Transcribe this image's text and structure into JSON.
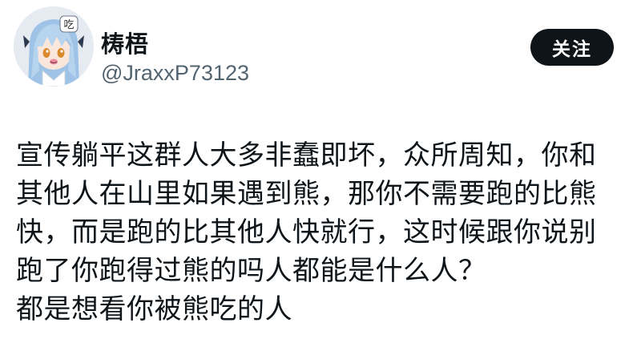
{
  "author": {
    "display_name": "梼梧",
    "handle": "@JraxxP73123",
    "avatar_icon": "anime-girl-avatar-icon",
    "avatar_badge_text": "吃"
  },
  "follow_button": {
    "label": "关注"
  },
  "tweet": {
    "lines": [
      "宣传躺平这群人大多非蠢即坏，众所周知，你和",
      "其他人在山里如果遇到熊，那你不需要跑的比熊",
      "快，而是跑的比其他人快就行，这时候跟你说别",
      "跑了你跑得过熊的吗人都能是什么人？",
      "都是想看你被熊吃的人"
    ]
  },
  "colors": {
    "text_primary": "#0f1419",
    "text_secondary": "#536471",
    "button_bg": "#0f1419",
    "button_text": "#ffffff"
  }
}
